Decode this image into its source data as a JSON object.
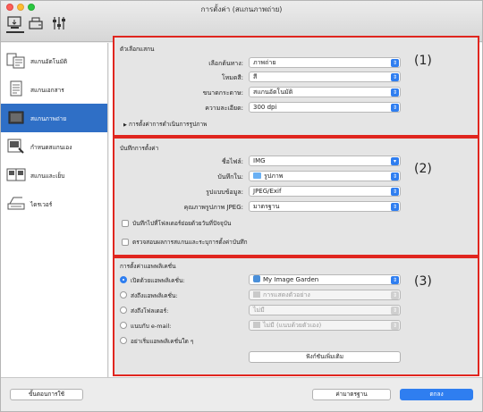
{
  "window": {
    "title": "การตั้งค่า (สแกนภาพถ่าย)"
  },
  "toolbar": [
    {
      "icon": "scan-from-computer-icon"
    },
    {
      "icon": "scan-from-panel-icon"
    },
    {
      "icon": "general-settings-icon"
    }
  ],
  "sidebar": {
    "items": [
      {
        "label": "สแกนอัตโนมัติ",
        "icon": "auto-scan-icon"
      },
      {
        "label": "สแกนเอกสาร",
        "icon": "document-scan-icon"
      },
      {
        "label": "สแกนภาพถ่าย",
        "icon": "photo-scan-icon",
        "selected": true
      },
      {
        "label": "กำหนดสแกนเอง",
        "icon": "custom-scan-icon"
      },
      {
        "label": "สแกนและเย็บ",
        "icon": "scan-stitch-icon"
      },
      {
        "label": "ไดรเวอร์",
        "icon": "driver-icon"
      }
    ]
  },
  "scan_options": {
    "title": "ตัวเลือกแสกน",
    "number": "(1)",
    "select_source_label": "เลือกต้นทาง:",
    "select_source_value": "ภาพถ่าย",
    "color_mode_label": "โหมดสี:",
    "color_mode_value": "สี",
    "paper_size_label": "ขนาดกระดาษ:",
    "paper_size_value": "สแกนอัตโนมัติ",
    "resolution_label": "ความละเอียด:",
    "resolution_value": "300 dpi",
    "image_processing_label": "การตั้งค่าการดำเนินการรูปภาพ"
  },
  "save_settings": {
    "title": "บันทึกการตั้งค่า",
    "number": "(2)",
    "file_name_label": "ชื่อไฟล์:",
    "file_name_value": "IMG",
    "save_in_label": "บันทึกใน:",
    "save_in_value": "รูปภาพ",
    "data_format_label": "รูปแบบข้อมูล:",
    "data_format_value": "JPEG/Exif",
    "jpeg_quality_label": "คุณภาพรูปภาพ JPEG:",
    "jpeg_quality_value": "มาตรฐาน",
    "subfolder_label": "บันทึกไปที่โฟลเดอร์ย่อยด้วยวันที่ปัจจุบัน",
    "check_results_label": "ตรวจสอบผลการสแกนและระบุการตั้งค่าบันทึก"
  },
  "app_settings": {
    "title": "การตั้งค่าแอพพลิเคชั่น",
    "number": "(3)",
    "open_with_label": "เปิดด้วยแอพพลิเคชั่น:",
    "open_with_value": "My Image Garden",
    "send_app_label": "ส่งถึงแอพพลิเคชั่น:",
    "send_app_value": "การแสดงตัวอย่าง",
    "send_folder_label": "ส่งถึงโฟลเดอร์:",
    "send_folder_value": "ไม่มี",
    "email_label": "แนบกับ e-mail:",
    "email_value": "ไม่มี (แนบด้วยตัวเอง)",
    "no_app_label": "อย่าเริ่มแอพพลิเคชั่นใด ๆ",
    "more_functions_label": "ฟังก์ชันเพิ่มเติม"
  },
  "footer": {
    "instructions_label": "ขั้นตอนการใช้",
    "defaults_label": "ค่ามาตรฐาน",
    "ok_label": "ตกลง"
  },
  "colors": {
    "accent": "#2f7ef0",
    "selection": "#2f6fc6",
    "highlight": "#e0261f"
  }
}
